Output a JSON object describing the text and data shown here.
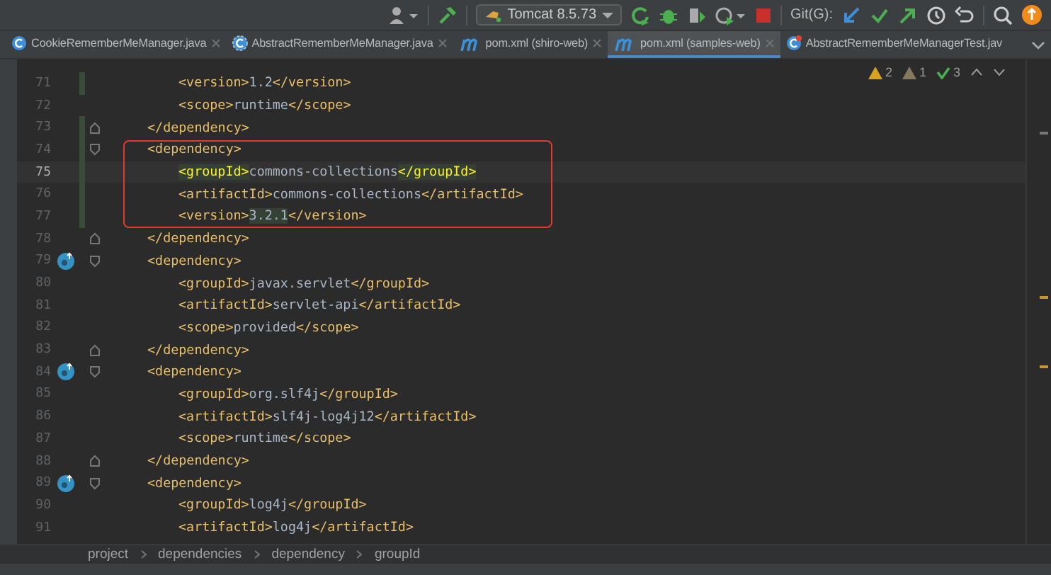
{
  "toolbar": {
    "run_config": "Tomcat 8.5.73",
    "git_label": "Git(G):"
  },
  "tabs": [
    {
      "label": "CookieRememberMeManager.java",
      "kind": "class",
      "selected": false
    },
    {
      "label": "AbstractRememberMeManager.java",
      "kind": "abstract",
      "selected": false
    },
    {
      "label": "pom.xml (shiro-web)",
      "kind": "maven",
      "selected": false
    },
    {
      "label": "pom.xml (samples-web)",
      "kind": "maven",
      "selected": true
    },
    {
      "label": "AbstractRememberMeManagerTest.jav",
      "kind": "test",
      "selected": false
    }
  ],
  "inspections": [
    {
      "kind": "warning",
      "count": "2"
    },
    {
      "kind": "weak",
      "count": "1"
    },
    {
      "kind": "ok",
      "count": "3"
    }
  ],
  "code": [
    {
      "kind": "line",
      "number": "71",
      "nested": true,
      "text": "<version>1.2</version>",
      "changed": true
    },
    {
      "kind": "line",
      "number": "72",
      "nested": true,
      "text": "<scope>runtime</scope>"
    },
    {
      "kind": "line",
      "number": "73",
      "nested": false,
      "text": "</dependency>",
      "changed": true,
      "fold_end": true
    },
    {
      "kind": "box",
      "lines": [
        {
          "kind": "line",
          "number": "74",
          "nested": false,
          "text": "<dependency>",
          "changed": true,
          "fold_start": true
        },
        {
          "kind": "line",
          "number": "75",
          "nested": true,
          "current": true,
          "changed": true,
          "segments": [
            {
              "text": "<groupId>",
              "marked": true
            },
            {
              "text": "commons-collections"
            },
            {
              "text": "</groupId>",
              "marked": true
            }
          ]
        },
        {
          "kind": "line",
          "number": "76",
          "nested": true,
          "text": "<artifactId>commons-collections</artifactId>",
          "changed": true
        },
        {
          "kind": "line",
          "number": "77",
          "nested": true,
          "changed": true,
          "segments": [
            {
              "text": "<version>"
            },
            {
              "text": "3.2.1",
              "marked": true
            },
            {
              "text": "</version>"
            }
          ]
        }
      ]
    },
    {
      "kind": "line",
      "number": "78",
      "nested": false,
      "text": "</dependency>",
      "fold_end": true
    },
    {
      "kind": "line",
      "number": "79",
      "nested": false,
      "text": "<dependency>",
      "fold_start": true,
      "gutter_icon": true
    },
    {
      "kind": "line",
      "number": "80",
      "nested": true,
      "text": "<groupId>javax.servlet</groupId>"
    },
    {
      "kind": "line",
      "number": "81",
      "nested": true,
      "text": "<artifactId>servlet-api</artifactId>"
    },
    {
      "kind": "line",
      "number": "82",
      "nested": true,
      "text": "<scope>provided</scope>"
    },
    {
      "kind": "line",
      "number": "83",
      "nested": false,
      "text": "</dependency>",
      "fold_end": true
    },
    {
      "kind": "line",
      "number": "84",
      "nested": false,
      "text": "<dependency>",
      "fold_start": true,
      "gutter_icon": true
    },
    {
      "kind": "line",
      "number": "85",
      "nested": true,
      "text": "<groupId>org.slf4j</groupId>"
    },
    {
      "kind": "line",
      "number": "86",
      "nested": true,
      "text": "<artifactId>slf4j-log4j12</artifactId>"
    },
    {
      "kind": "line",
      "number": "87",
      "nested": true,
      "text": "<scope>runtime</scope>"
    },
    {
      "kind": "line",
      "number": "88",
      "nested": false,
      "text": "</dependency>",
      "fold_end": true
    },
    {
      "kind": "line",
      "number": "89",
      "nested": false,
      "text": "<dependency>",
      "fold_start": true,
      "gutter_icon": true
    },
    {
      "kind": "line",
      "number": "90",
      "nested": true,
      "text": "<groupId>log4j</groupId>"
    },
    {
      "kind": "line",
      "number": "91",
      "nested": true,
      "text": "<artifactId>log4j</artifactId>"
    }
  ],
  "breadcrumbs": [
    "project",
    "dependencies",
    "dependency",
    "groupId"
  ]
}
